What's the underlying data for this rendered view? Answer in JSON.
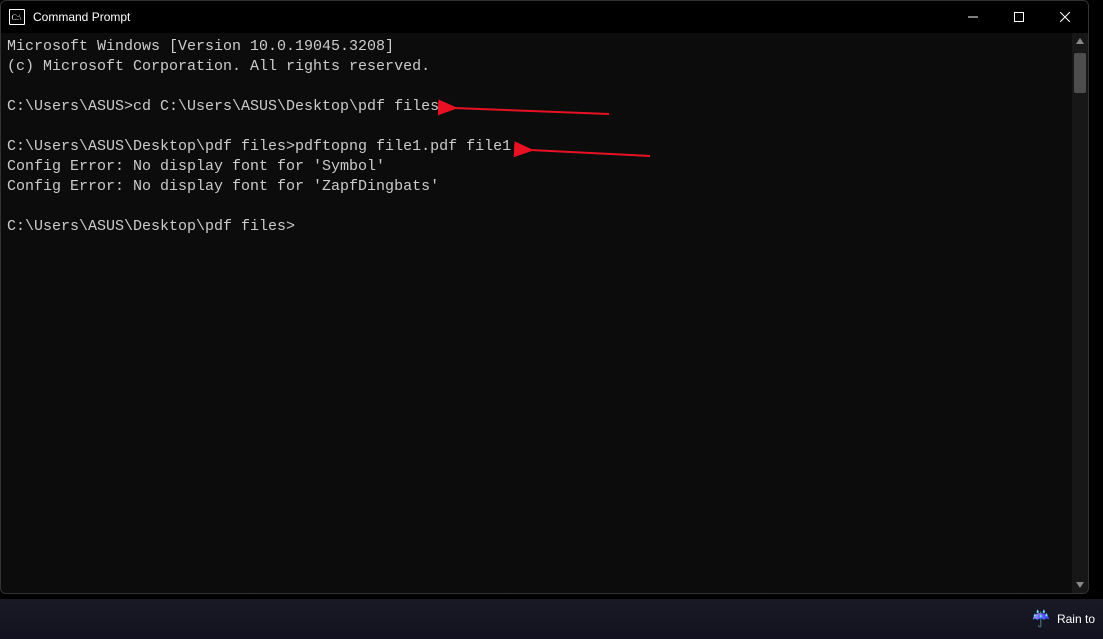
{
  "window": {
    "title": "Command Prompt"
  },
  "terminal": {
    "lines": [
      "Microsoft Windows [Version 10.0.19045.3208]",
      "(c) Microsoft Corporation. All rights reserved.",
      "",
      "C:\\Users\\ASUS>cd C:\\Users\\ASUS\\Desktop\\pdf files",
      "",
      "C:\\Users\\ASUS\\Desktop\\pdf files>pdftopng file1.pdf file1",
      "Config Error: No display font for 'Symbol'",
      "Config Error: No display font for 'ZapfDingbats'",
      "",
      "C:\\Users\\ASUS\\Desktop\\pdf files>"
    ]
  },
  "taskbar": {
    "weather_text": "Rain to"
  },
  "annotations": {
    "arrow_color": "#e81123"
  }
}
